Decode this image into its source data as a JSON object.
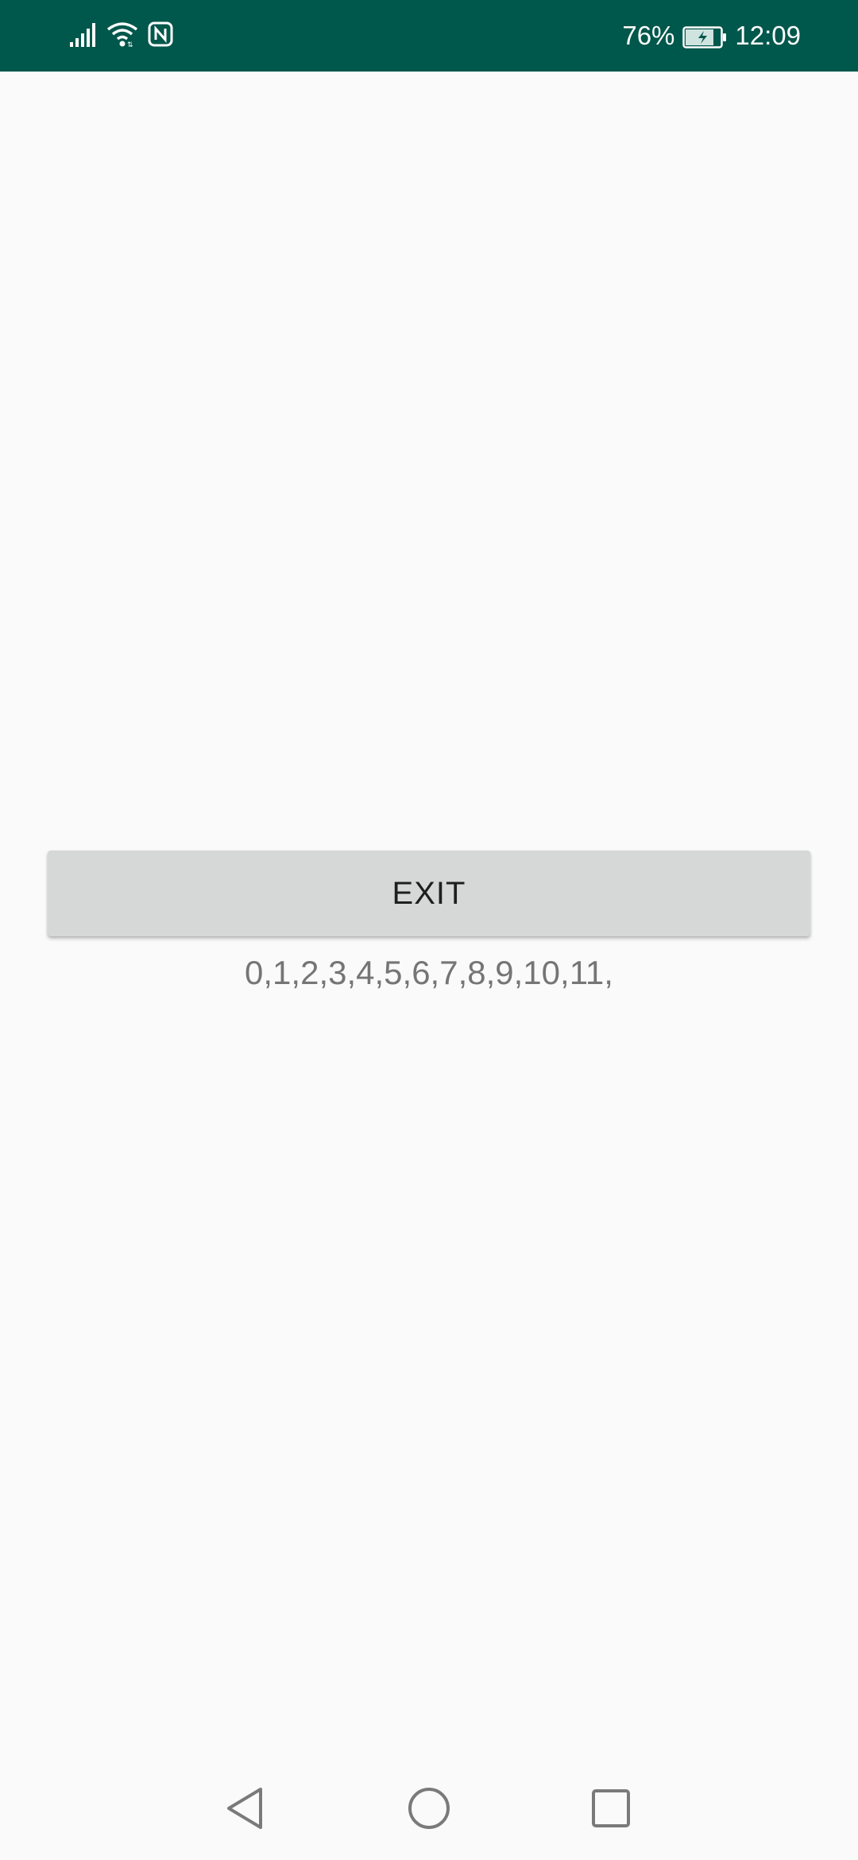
{
  "status_bar": {
    "battery_percent": "76%",
    "time": "12:09",
    "icons": [
      "signal-icon",
      "wifi-icon",
      "nfc-icon",
      "battery-charging-icon"
    ],
    "background_color": "#00574b"
  },
  "main": {
    "exit_button_label": "EXIT",
    "counter_text": "0,1,2,3,4,5,6,7,8,9,10,11,"
  },
  "nav_bar": {
    "icons": [
      "back-icon",
      "home-icon",
      "recents-icon"
    ]
  }
}
